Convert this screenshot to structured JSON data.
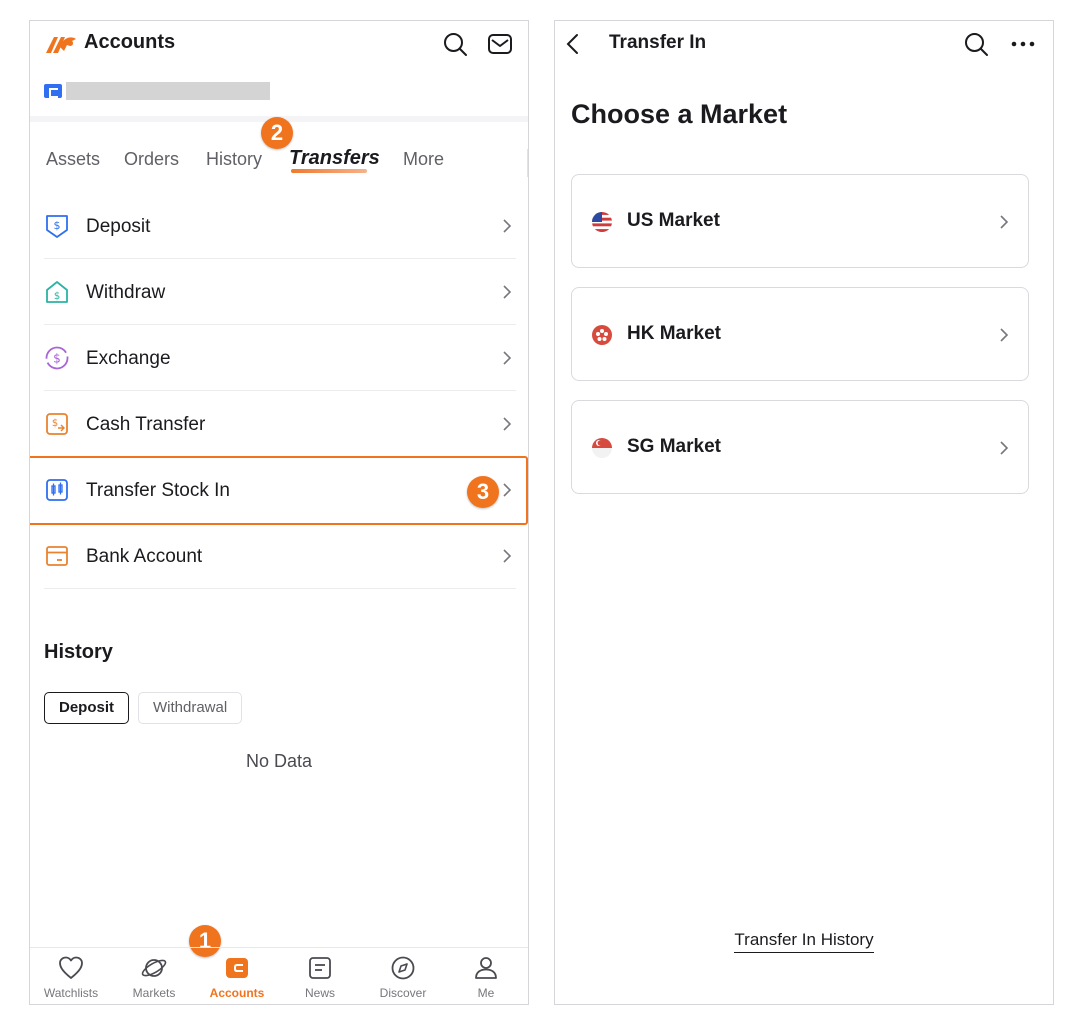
{
  "left": {
    "header": {
      "title": "Accounts"
    },
    "tabs": [
      {
        "label": "Assets"
      },
      {
        "label": "Orders"
      },
      {
        "label": "History"
      },
      {
        "label": "Transfers"
      },
      {
        "label": "More"
      }
    ],
    "menu": [
      {
        "label": "Deposit",
        "icon": "deposit-icon"
      },
      {
        "label": "Withdraw",
        "icon": "withdraw-icon"
      },
      {
        "label": "Exchange",
        "icon": "exchange-icon"
      },
      {
        "label": "Cash Transfer",
        "icon": "cash-transfer-icon"
      },
      {
        "label": "Transfer Stock In",
        "icon": "transfer-stock-icon"
      },
      {
        "label": "Bank Account",
        "icon": "bank-account-icon"
      }
    ],
    "history": {
      "title": "History",
      "chips": [
        "Deposit",
        "Withdrawal"
      ],
      "empty": "No Data"
    },
    "steps": [
      "1",
      "2",
      "3"
    ],
    "tabbar": [
      {
        "label": "Watchlists",
        "icon": "heart-icon"
      },
      {
        "label": "Markets",
        "icon": "planet-icon"
      },
      {
        "label": "Accounts",
        "icon": "wallet-icon"
      },
      {
        "label": "News",
        "icon": "news-icon"
      },
      {
        "label": "Discover",
        "icon": "compass-icon"
      },
      {
        "label": "Me",
        "icon": "person-icon"
      }
    ],
    "colors": {
      "accent": "#f0741e",
      "badge_blue": "#2f6ff0"
    }
  },
  "right": {
    "header": {
      "title": "Transfer In"
    },
    "heading": "Choose a Market",
    "markets": [
      {
        "label": "US Market",
        "icon": "us-flag-icon"
      },
      {
        "label": "HK Market",
        "icon": "hk-flag-icon"
      },
      {
        "label": "SG Market",
        "icon": "sg-flag-icon"
      }
    ],
    "history_link": "Transfer In History"
  }
}
